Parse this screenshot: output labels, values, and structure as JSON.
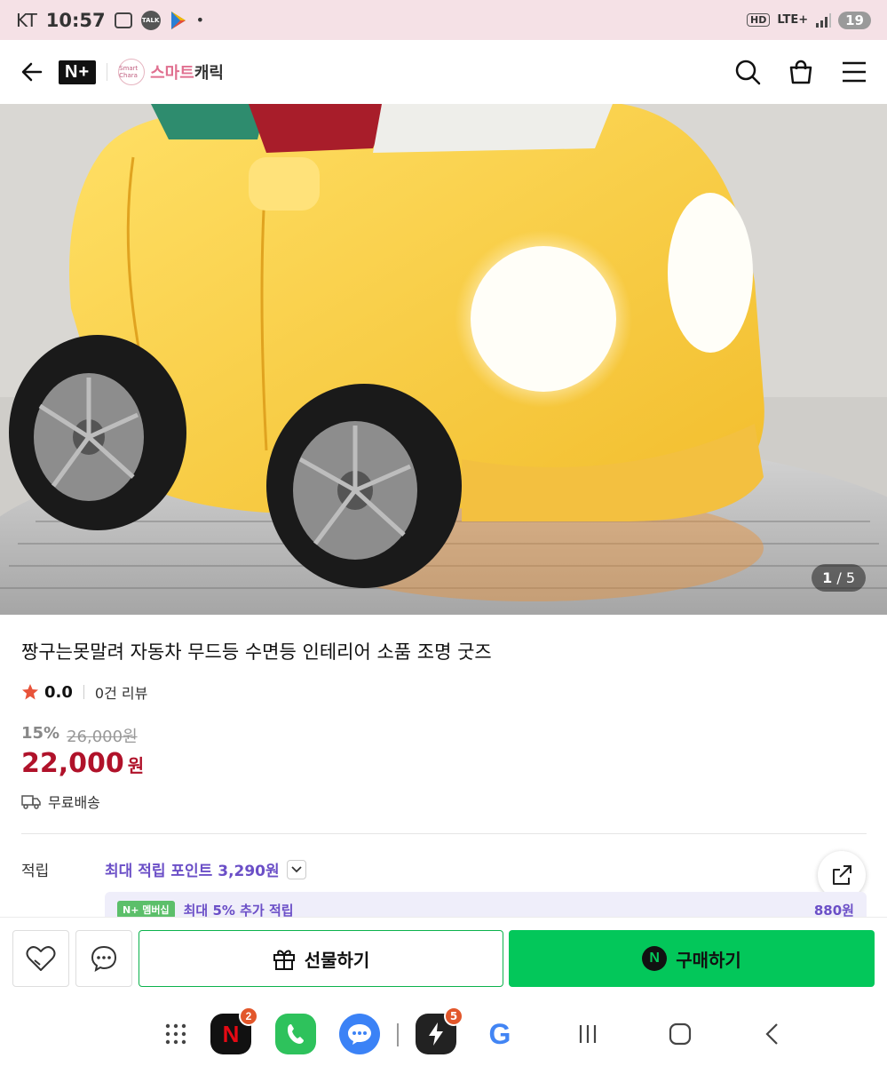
{
  "status_bar": {
    "carrier": "KT",
    "time": "10:57",
    "talk_label": "TALK",
    "dot": "•",
    "hd": "HD",
    "network": "LTE+",
    "battery": "19"
  },
  "header": {
    "logo_text": "N+",
    "store_logo_text": "Smart Chara",
    "store_name_accent": "스마트",
    "store_name_rest": "캐릭",
    "icons": [
      "back-arrow-icon",
      "search-icon",
      "shopping-bag-icon",
      "menu-icon"
    ]
  },
  "hero": {
    "image_alt": "yellow toy car mood lamp",
    "counter_current": "1",
    "counter_separator": " / ",
    "counter_total": "5"
  },
  "product": {
    "title": "짱구는못말려 자동차 무드등 수면등 인테리어 소품 조명 굿즈",
    "rating": "0.0",
    "review_count": "0건 리뷰",
    "discount_rate": "15%",
    "original_price": "26,000원",
    "price": "22,000",
    "price_unit": "원",
    "delivery": "무료배송"
  },
  "points": {
    "label": "적립",
    "value": "최대 적립 포인트 3,290원",
    "membership_badge": "N+ 멤버십",
    "membership_text": "최대 5% 추가 적립",
    "membership_amount": "880원"
  },
  "actions": {
    "gift_label": "선물하기",
    "buy_label": "구매하기",
    "buy_logo": "N"
  },
  "nav_bar": {
    "netflix_badge": "2",
    "bolt_badge": "5",
    "netflix_letter": "N",
    "google_letter": "G"
  },
  "colors": {
    "accent_green": "#03c75a",
    "price_red": "#b0122a",
    "points_purple": "#6b4fc7",
    "status_bar_pink": "#f5e1e6"
  }
}
